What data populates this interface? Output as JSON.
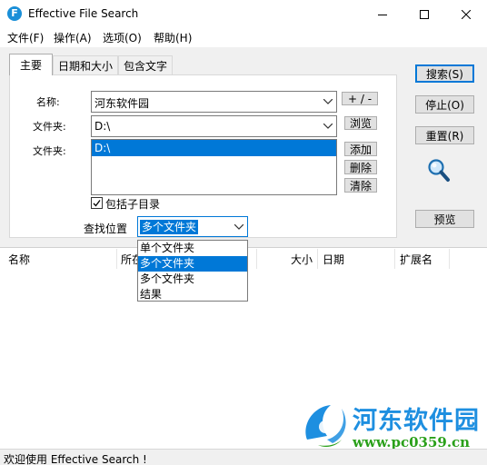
{
  "window": {
    "title": "Effective File Search",
    "app_icon_letter": "F"
  },
  "menubar": {
    "items": [
      "文件(F)",
      "操作(A)",
      "选项(O)",
      "帮助(H)"
    ]
  },
  "tabs": [
    {
      "label": "主要",
      "active": true
    },
    {
      "label": "日期和大小",
      "active": false
    },
    {
      "label": "包含文字",
      "active": false
    }
  ],
  "form": {
    "name_label": "名称:",
    "name_value": "河东软件园",
    "name_plusminus": "+ / -",
    "folder_label": "文件夹:",
    "folder_value": "D:\\",
    "browse_label": "浏览",
    "folders_label": "文件夹:",
    "folders_list": [
      "D:\\"
    ],
    "add_label": "添加",
    "delete_label": "删除",
    "clear_label": "清除",
    "subdir_label": "包括子目录",
    "subdir_checked": true,
    "location_label": "查找位置",
    "location_value": "多个文件夹",
    "location_options": [
      "单个文件夹",
      "多个文件夹",
      "多个文件夹",
      "结果"
    ],
    "location_highlighted_index": 1
  },
  "actions": {
    "search": "搜索(S)",
    "stop": "停止(O)",
    "reset": "重置(R)",
    "preview": "预览"
  },
  "results": {
    "columns": [
      "名称",
      "所在",
      "大小",
      "日期",
      "扩展名"
    ]
  },
  "status": {
    "text": "欢迎使用 Effective Search !"
  },
  "watermark": {
    "name": "河东软件园",
    "url": "www.pc0359.cn"
  },
  "colors": {
    "accent": "#0078d7",
    "watermark_blue": "#1e8fe0",
    "watermark_green": "#2aa01a"
  }
}
